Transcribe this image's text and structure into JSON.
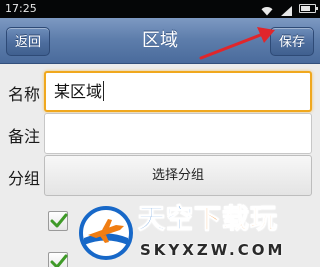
{
  "status_bar": {
    "time": "17:25",
    "icons": [
      "wifi-icon",
      "signal-icon",
      "battery-icon"
    ],
    "battery_level": 0.7
  },
  "header": {
    "back_label": "返回",
    "title": "区域",
    "save_label": "保存"
  },
  "form": {
    "name_label": "名称",
    "name_value": "某区域",
    "note_label": "备注",
    "note_value": "",
    "group_label": "分组",
    "group_button_label": "选择分组",
    "checkboxes": [
      {
        "checked": true
      },
      {
        "checked": true
      }
    ]
  },
  "watermark": {
    "logo_icon": "airplane-logo-icon",
    "brand_main": "天空",
    "brand_accent": "下载玩",
    "domain": "SKYXZW.COM"
  },
  "colors": {
    "titlebar": "#5d7dab",
    "focus_border": "#f0a81e",
    "annotation_arrow": "#e0262b",
    "check": "#3f9a28",
    "watermark_blue": "#1768c8",
    "watermark_orange": "#f07d12"
  }
}
